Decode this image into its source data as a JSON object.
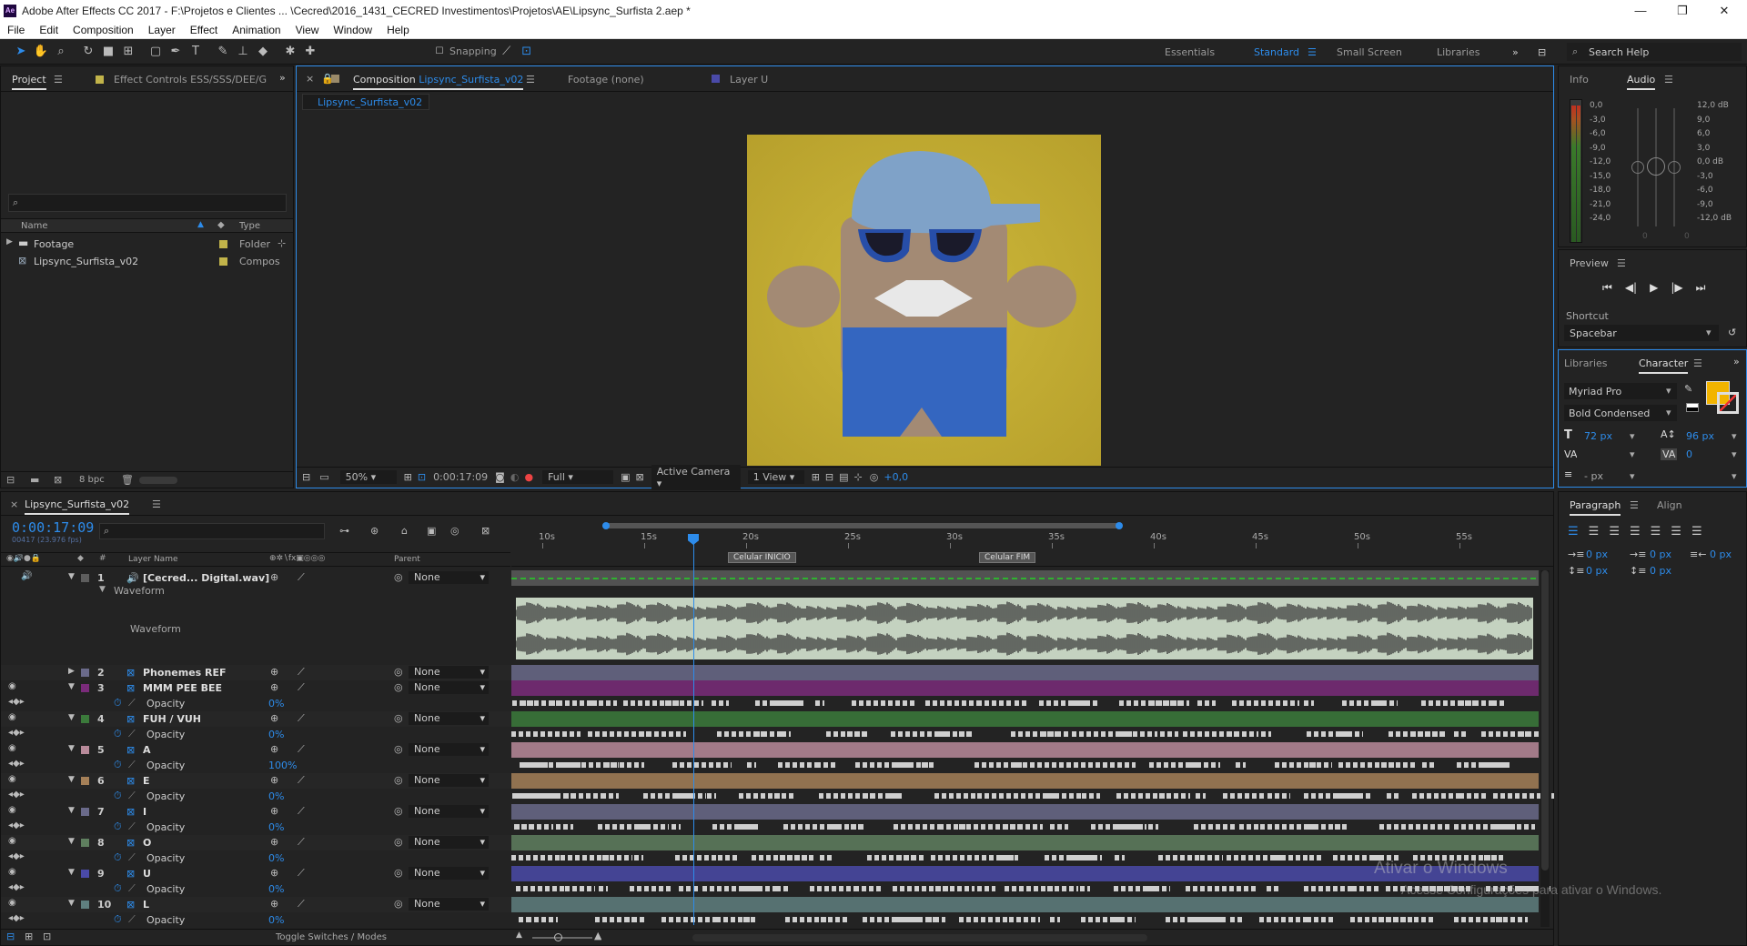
{
  "window": {
    "title": "Adobe After Effects CC 2017 - F:\\Projetos e Clientes ... \\Cecred\\2016_1431_CECRED Investimentos\\Projetos\\AE\\Lipsync_Surfista 2.aep *",
    "minimize": "—",
    "maximize": "❐",
    "close": "✕"
  },
  "menu": [
    "File",
    "Edit",
    "Composition",
    "Layer",
    "Effect",
    "Animation",
    "View",
    "Window",
    "Help"
  ],
  "toolbar": {
    "snapping_label": "Snapping",
    "workspaces": [
      "Essentials",
      "Standard",
      "Small Screen",
      "Libraries"
    ],
    "active_workspace": "Standard",
    "search_placeholder": "Search Help"
  },
  "project_panel": {
    "tab_project": "Project",
    "tab_effects": "Effect Controls ESS/SSS/DEE/G",
    "col_name": "Name",
    "col_type": "Type",
    "items": [
      {
        "name": "Footage",
        "type": "Folder",
        "color": "#c2b44a"
      },
      {
        "name": "Lipsync_Surfista_v02",
        "type": "Compos",
        "color": "#c2b44a"
      }
    ],
    "bpc": "8 bpc"
  },
  "viewer": {
    "tab_comp_prefix": "Composition",
    "tab_comp_name": "Lipsync_Surfista_v02",
    "tab_footage": "Footage (none)",
    "tab_layer": "Layer U",
    "breadcrumb": "Lipsync_Surfista_v02",
    "zoom": "50%",
    "timecode": "0:00:17:09",
    "resolution": "Full",
    "camera": "Active Camera",
    "views": "1 View",
    "exposure": "+0,0"
  },
  "info_audio": {
    "tab_info": "Info",
    "tab_audio": "Audio",
    "left_scale": [
      "0,0",
      "-3,0",
      "-6,0",
      "-9,0",
      "-12,0",
      "-15,0",
      "-18,0",
      "-21,0",
      "-24,0"
    ],
    "right_scale": [
      "12,0 dB",
      "9,0",
      "6,0",
      "3,0",
      "0,0 dB",
      "-3,0",
      "-6,0",
      "-9,0",
      "-12,0 dB"
    ],
    "zero_left": "0",
    "zero_right": "0"
  },
  "preview": {
    "title": "Preview",
    "shortcut_label": "Shortcut",
    "shortcut_value": "Spacebar"
  },
  "character": {
    "tab_libraries": "Libraries",
    "tab_character": "Character",
    "font": "Myriad Pro",
    "style": "Bold Condensed",
    "size": "72 px",
    "leading": "96 px",
    "tracking": "0",
    "fill_color": "#f2b400",
    "baseline": "- px"
  },
  "paragraph": {
    "tab_paragraph": "Paragraph",
    "tab_align": "Align",
    "indent_left": "0 px",
    "indent_first": "0 px",
    "indent_right": "0 px",
    "space_before": "0 px",
    "space_after": "0 px"
  },
  "timeline": {
    "tab": "Lipsync_Surfista_v02",
    "timecode": "0:00:17:09",
    "frames": "00417 (23.976 fps)",
    "col_layer_name": "Layer Name",
    "col_parent": "Parent",
    "ruler": [
      "10s",
      "15s",
      "20s",
      "25s",
      "30s",
      "35s",
      "40s",
      "45s",
      "50s",
      "55s"
    ],
    "markers": [
      "Celular INICIO",
      "Celular FIM"
    ],
    "waveform_group": "Waveform",
    "waveform_label": "Waveform",
    "toggle_label": "Toggle Switches / Modes",
    "layers": [
      {
        "num": "1",
        "name": "[Cecred... Digital.wav]",
        "parent": "None",
        "color": "#5d5d5d",
        "prop": ""
      },
      {
        "num": "2",
        "name": "Phonemes REF",
        "parent": "None",
        "color": "#6a6a8a",
        "prop": ""
      },
      {
        "num": "3",
        "name": "MMM PEE BEE",
        "parent": "None",
        "color": "#7a2b7a",
        "prop": "Opacity",
        "value": "0%"
      },
      {
        "num": "4",
        "name": "FUH / VUH",
        "parent": "None",
        "color": "#3b7a3b",
        "prop": "Opacity",
        "value": "0%"
      },
      {
        "num": "5",
        "name": "A",
        "parent": "None",
        "color": "#b88a9a",
        "prop": "Opacity",
        "value": "100%"
      },
      {
        "num": "6",
        "name": "E",
        "parent": "None",
        "color": "#a58058",
        "prop": "Opacity",
        "value": "0%"
      },
      {
        "num": "7",
        "name": "I",
        "parent": "None",
        "color": "#6a6a8a",
        "prop": "Opacity",
        "value": "0%"
      },
      {
        "num": "8",
        "name": "O",
        "parent": "None",
        "color": "#5f7f5f",
        "prop": "Opacity",
        "value": "0%"
      },
      {
        "num": "9",
        "name": "U",
        "parent": "None",
        "color": "#4a4aa8",
        "prop": "Opacity",
        "value": "0%"
      },
      {
        "num": "10",
        "name": "L",
        "parent": "None",
        "color": "#5f7f7f",
        "prop": "Opacity",
        "value": "0%"
      }
    ]
  },
  "watermark": {
    "line1": "Ativar o Windows",
    "line2": "Acesse Configurações para ativar o Windows."
  }
}
